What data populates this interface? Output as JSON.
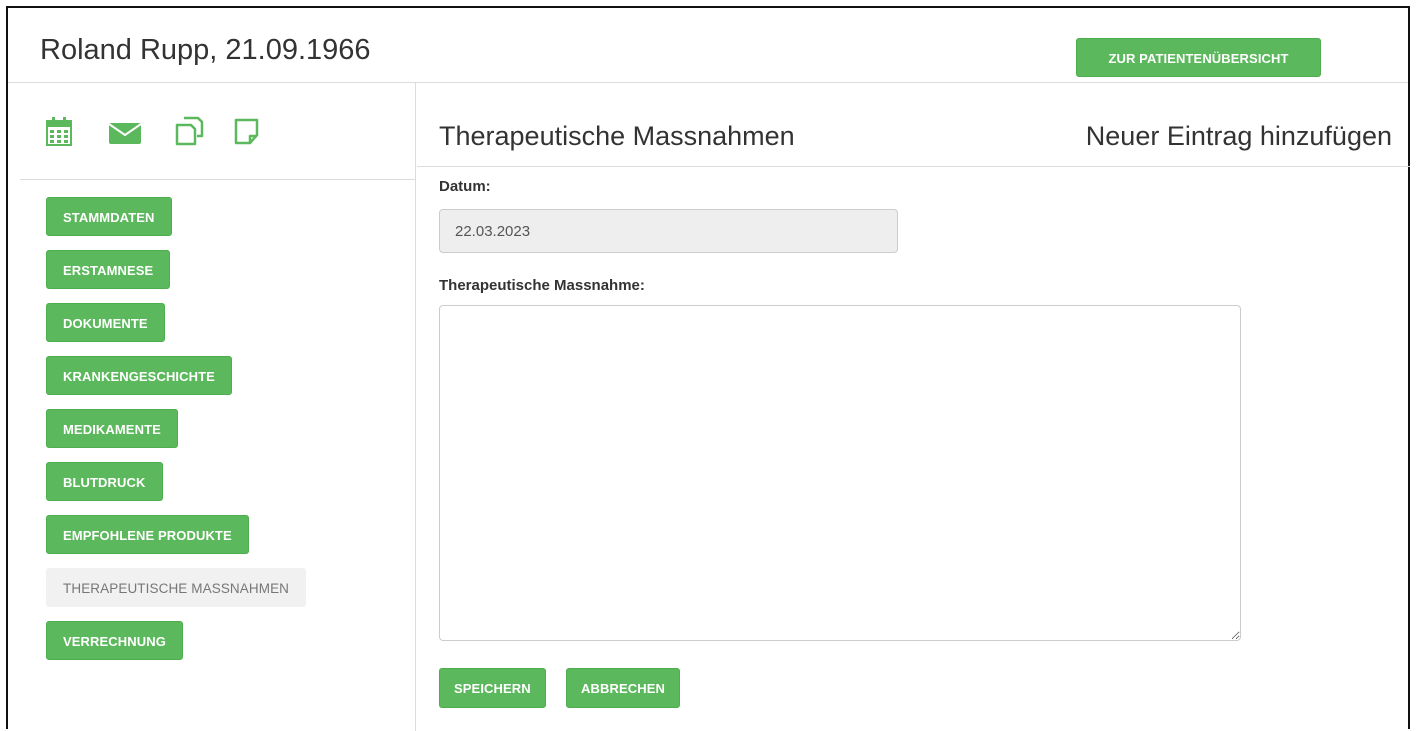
{
  "header": {
    "patient_name": "Roland Rupp, 21.09.1966",
    "overview_button": "ZUR PATIENTENÜBERSICHT"
  },
  "sidebar": {
    "icons": [
      "calendar-icon",
      "envelope-icon",
      "copy-icon",
      "note-icon"
    ],
    "items": [
      {
        "label": "STAMMDATEN",
        "active": true
      },
      {
        "label": "ERSTAMNESE",
        "active": true
      },
      {
        "label": "DOKUMENTE",
        "active": true
      },
      {
        "label": "KRANKENGESCHICHTE",
        "active": true
      },
      {
        "label": "MEDIKAMENTE",
        "active": true
      },
      {
        "label": "BLUTDRUCK",
        "active": true
      },
      {
        "label": "EMPFOHLENE PRODUKTE",
        "active": true
      },
      {
        "label": "THERAPEUTISCHE MASSNAHMEN",
        "active": false
      },
      {
        "label": "VERRECHNUNG",
        "active": true
      }
    ]
  },
  "main": {
    "title": "Therapeutische Massnahmen",
    "action_title": "Neuer Eintrag hinzufügen",
    "date_label": "Datum:",
    "date_value": "22.03.2023",
    "measure_label": "Therapeutische Massnahme:",
    "measure_value": "",
    "save_label": "SPEICHERN",
    "cancel_label": "ABBRECHEN"
  },
  "colors": {
    "accent_green": "#5cb85c",
    "inactive_bg": "#f1f1f1",
    "border": "#dcdcdc"
  }
}
